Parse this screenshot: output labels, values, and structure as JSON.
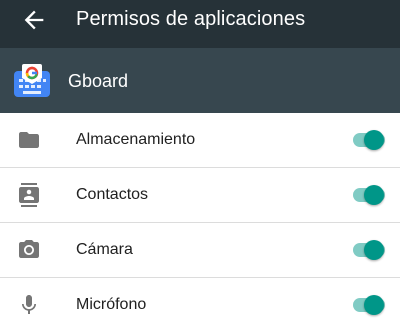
{
  "app_bar": {
    "title": "Permisos de aplicaciones",
    "back_icon": "arrow-back-icon"
  },
  "app_header": {
    "name": "Gboard",
    "icon": "gboard-logo"
  },
  "permissions": [
    {
      "label": "Almacenamiento",
      "icon": "folder-icon",
      "enabled": true
    },
    {
      "label": "Contactos",
      "icon": "contacts-icon",
      "enabled": true
    },
    {
      "label": "Cámara",
      "icon": "camera-icon",
      "enabled": true
    },
    {
      "label": "Micrófono",
      "icon": "microphone-icon",
      "enabled": true
    }
  ],
  "colors": {
    "app_bar": "#263238",
    "app_header": "#37474f",
    "toggle_thumb": "#009688",
    "toggle_track": "#80cbc4",
    "icon": "#757575"
  }
}
